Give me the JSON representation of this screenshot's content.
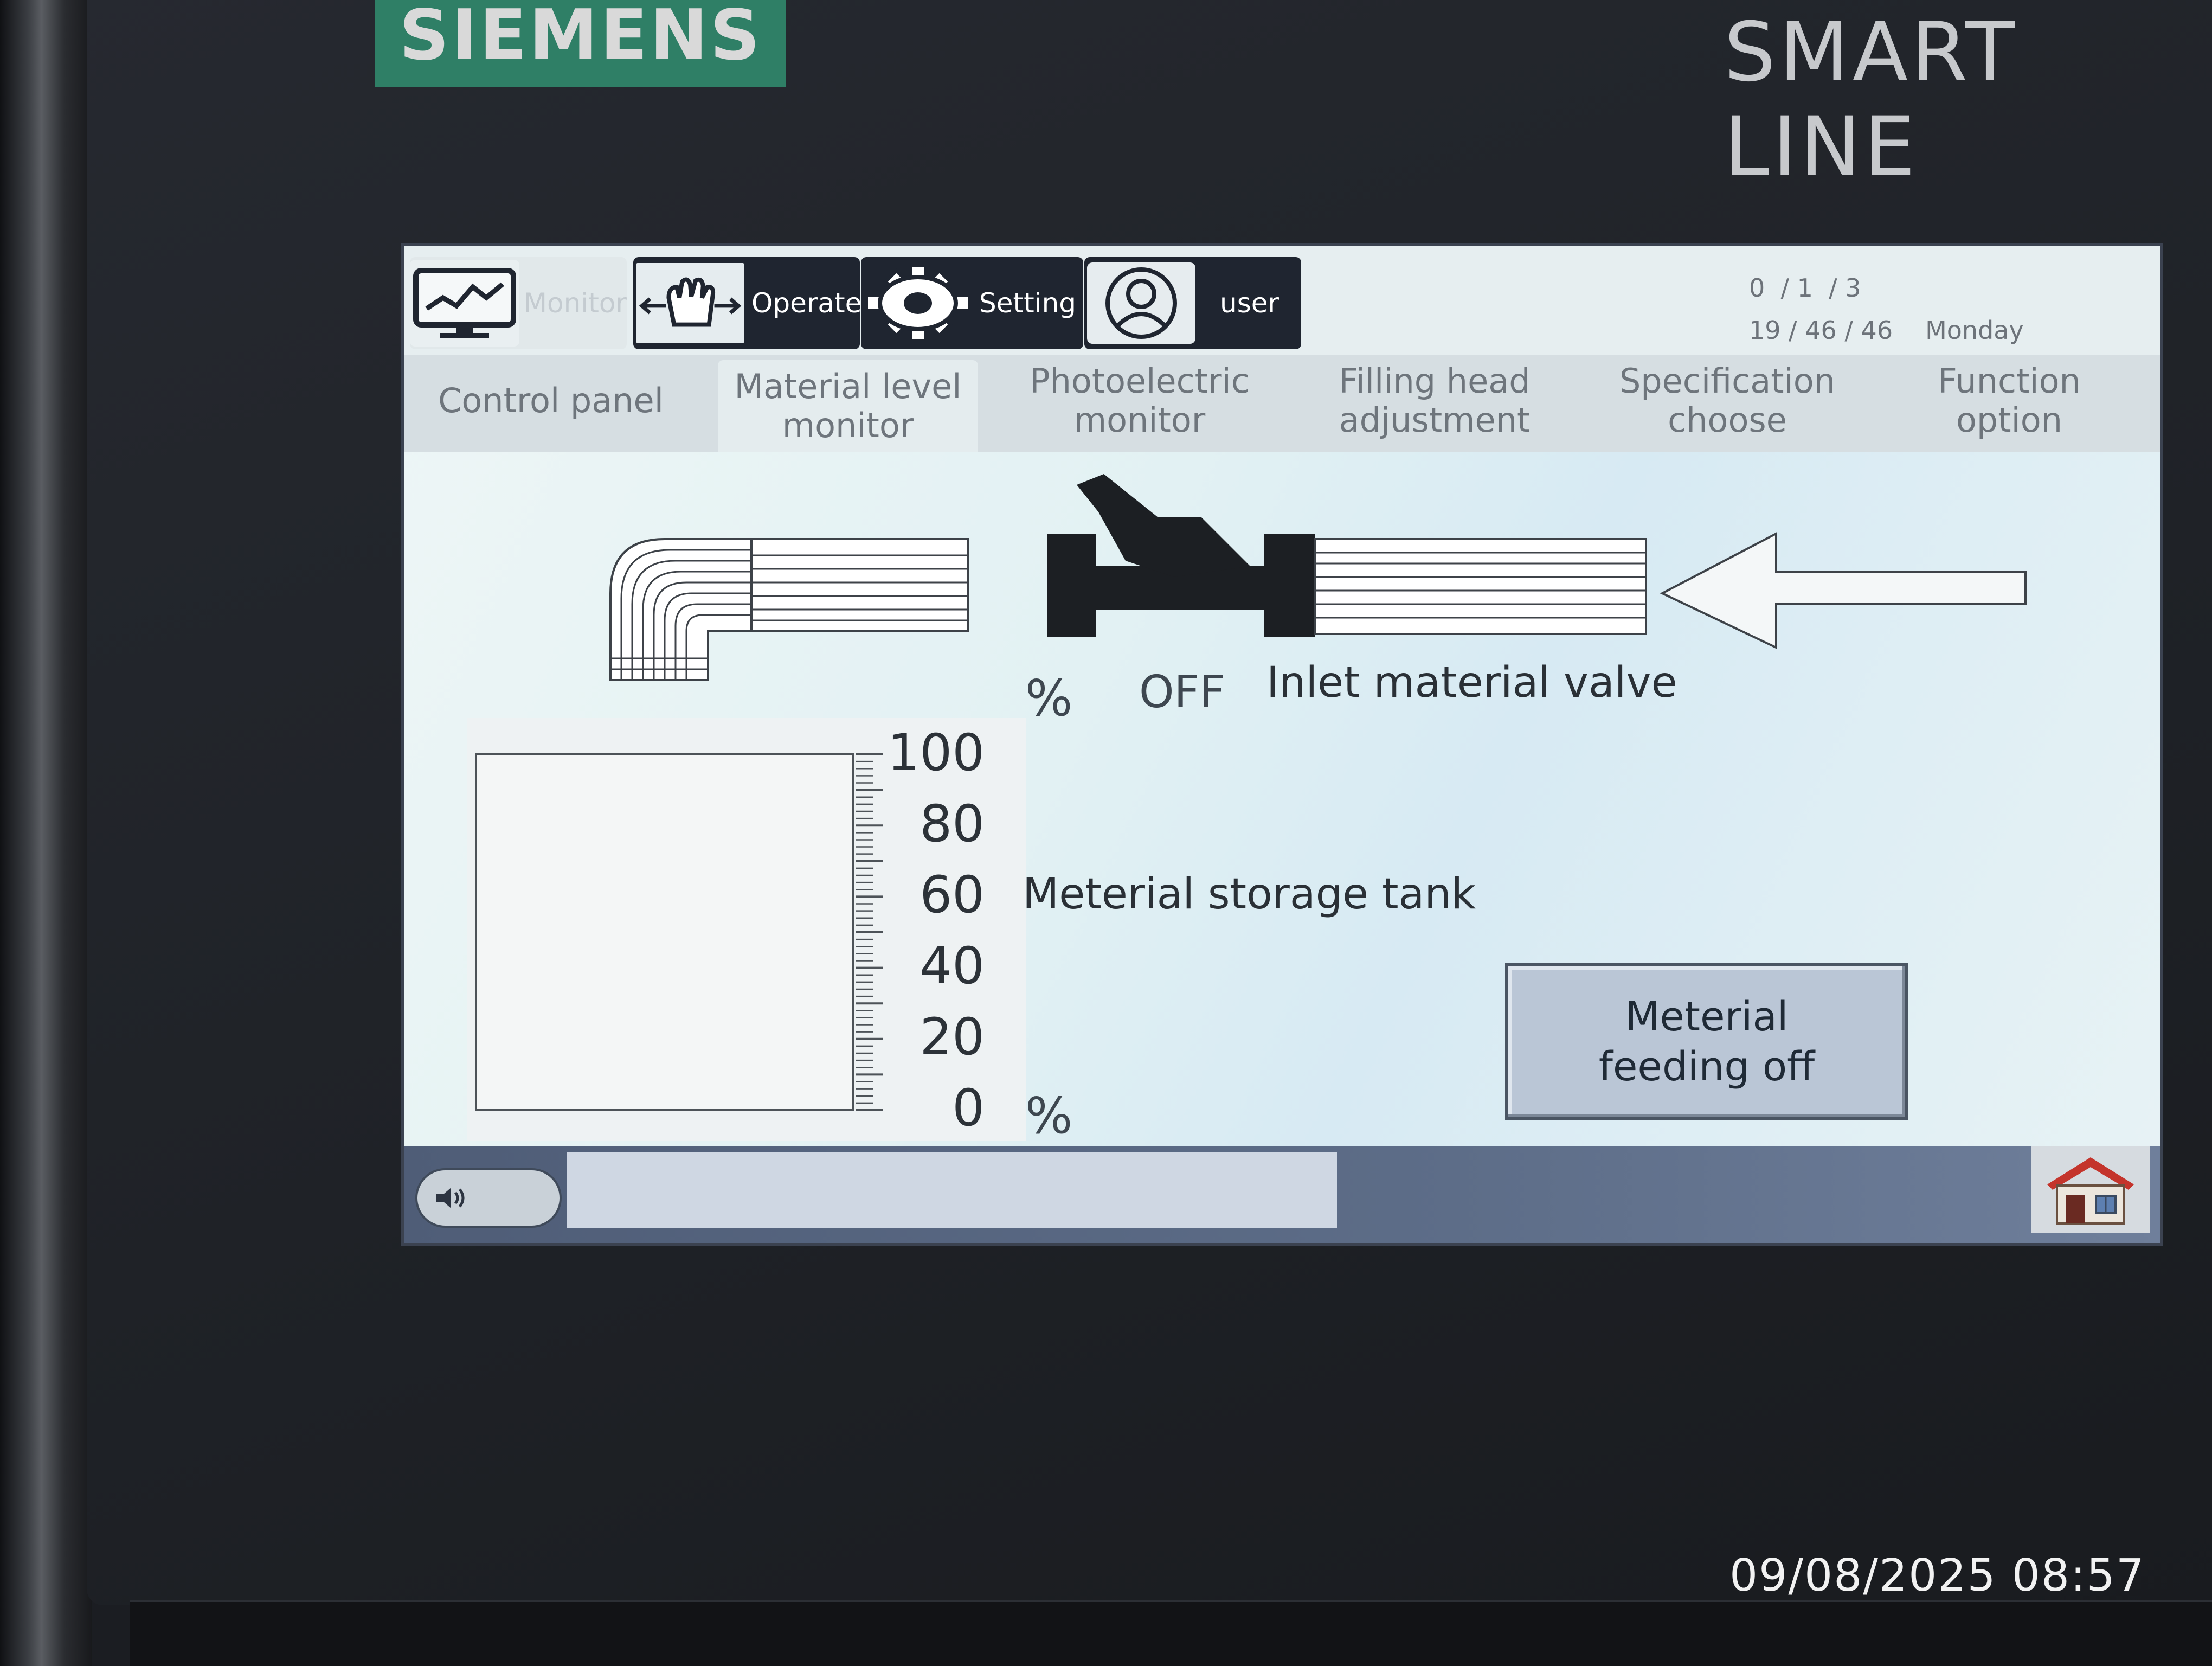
{
  "device": {
    "brand": "SIEMENS",
    "product_line": "SMART LINE",
    "photo_timestamp": "09/08/2025 08:57"
  },
  "menu": {
    "monitor_label": "Monitor",
    "operate_label": "Operate",
    "setting_label": "Setting",
    "user_label": "user",
    "icons": [
      "monitor-icon",
      "hand-icon",
      "gear-icon",
      "user-icon"
    ]
  },
  "clock": {
    "date": "0  / 1  / 3",
    "time": "19 / 46 / 46",
    "weekday": "Monday"
  },
  "tabs": [
    {
      "label": "Control panel"
    },
    {
      "label": "Material level\nmonitor",
      "active": true
    },
    {
      "label": "Photoelectric\nmonitor"
    },
    {
      "label": "Filling head\nadjustment"
    },
    {
      "label": "Specification\nchoose"
    },
    {
      "label": "Function\noption"
    }
  ],
  "valve": {
    "unit": "%",
    "state": "OFF",
    "label": "Inlet material valve"
  },
  "tank": {
    "label": "Meterial storage tank",
    "scale_ticks": [
      "100",
      "80",
      "60",
      "40",
      "20",
      "0"
    ],
    "unit": "%",
    "fill_percent": 0
  },
  "feed_button": {
    "label": "Meterial\nfeeding off"
  },
  "statusbar": {
    "sound_icon": "speaker-icon",
    "message": "",
    "home_icon": "home-icon"
  },
  "colors": {
    "menu_active_bg": "#1f2530",
    "screen_bg": "#e2f1f3",
    "button_bg": "#bac6d6",
    "brand_green": "#2f7f66"
  }
}
